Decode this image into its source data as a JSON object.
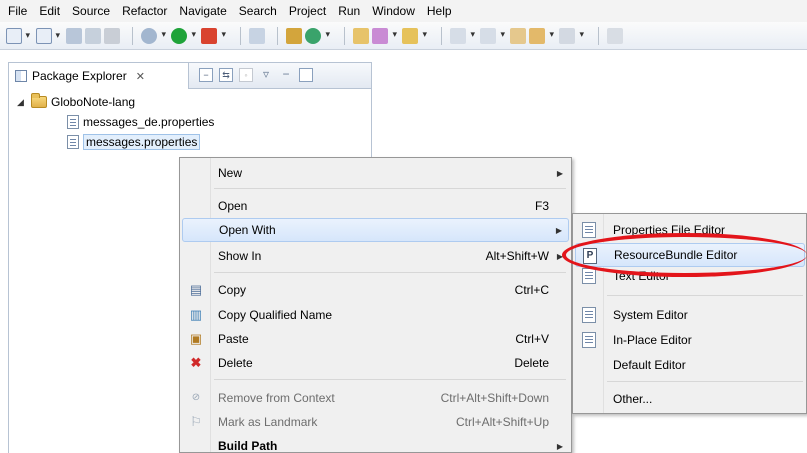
{
  "menubar": {
    "items": [
      {
        "label": "File"
      },
      {
        "label": "Edit"
      },
      {
        "label": "Source"
      },
      {
        "label": "Refactor"
      },
      {
        "label": "Navigate"
      },
      {
        "label": "Search"
      },
      {
        "label": "Project"
      },
      {
        "label": "Run"
      },
      {
        "label": "Window"
      },
      {
        "label": "Help"
      }
    ]
  },
  "package_explorer": {
    "title": "Package Explorer",
    "close_glyph": "✕",
    "tree": {
      "project": "GloboNote-lang",
      "files": [
        "messages_de.properties",
        "messages.properties"
      ]
    }
  },
  "context_menu": {
    "new": {
      "label": "New"
    },
    "open": {
      "label": "Open",
      "shortcut": "F3"
    },
    "open_with": {
      "label": "Open With"
    },
    "show_in": {
      "label": "Show In",
      "shortcut": "Alt+Shift+W"
    },
    "copy": {
      "label": "Copy",
      "shortcut": "Ctrl+C"
    },
    "copy_qualified": {
      "label": "Copy Qualified Name"
    },
    "paste": {
      "label": "Paste",
      "shortcut": "Ctrl+V"
    },
    "delete": {
      "label": "Delete",
      "shortcut": "Delete"
    },
    "remove_context": {
      "label": "Remove from Context",
      "shortcut": "Ctrl+Alt+Shift+Down"
    },
    "landmark": {
      "label": "Mark as Landmark",
      "shortcut": "Ctrl+Alt+Shift+Up"
    },
    "build_path": {
      "label": "Build Path"
    }
  },
  "open_with_submenu": {
    "properties_editor": "Properties File Editor",
    "resourcebundle_editor": "ResourceBundle Editor",
    "text_editor": "Text Editor",
    "system_editor": "System Editor",
    "inplace_editor": "In-Place Editor",
    "default_editor": "Default Editor",
    "other": "Other...",
    "p_glyph": "P"
  },
  "colors": {
    "annotation": "#e3151b",
    "highlight": "#d6e6fb",
    "menu_bg": "#f0f0f0"
  }
}
